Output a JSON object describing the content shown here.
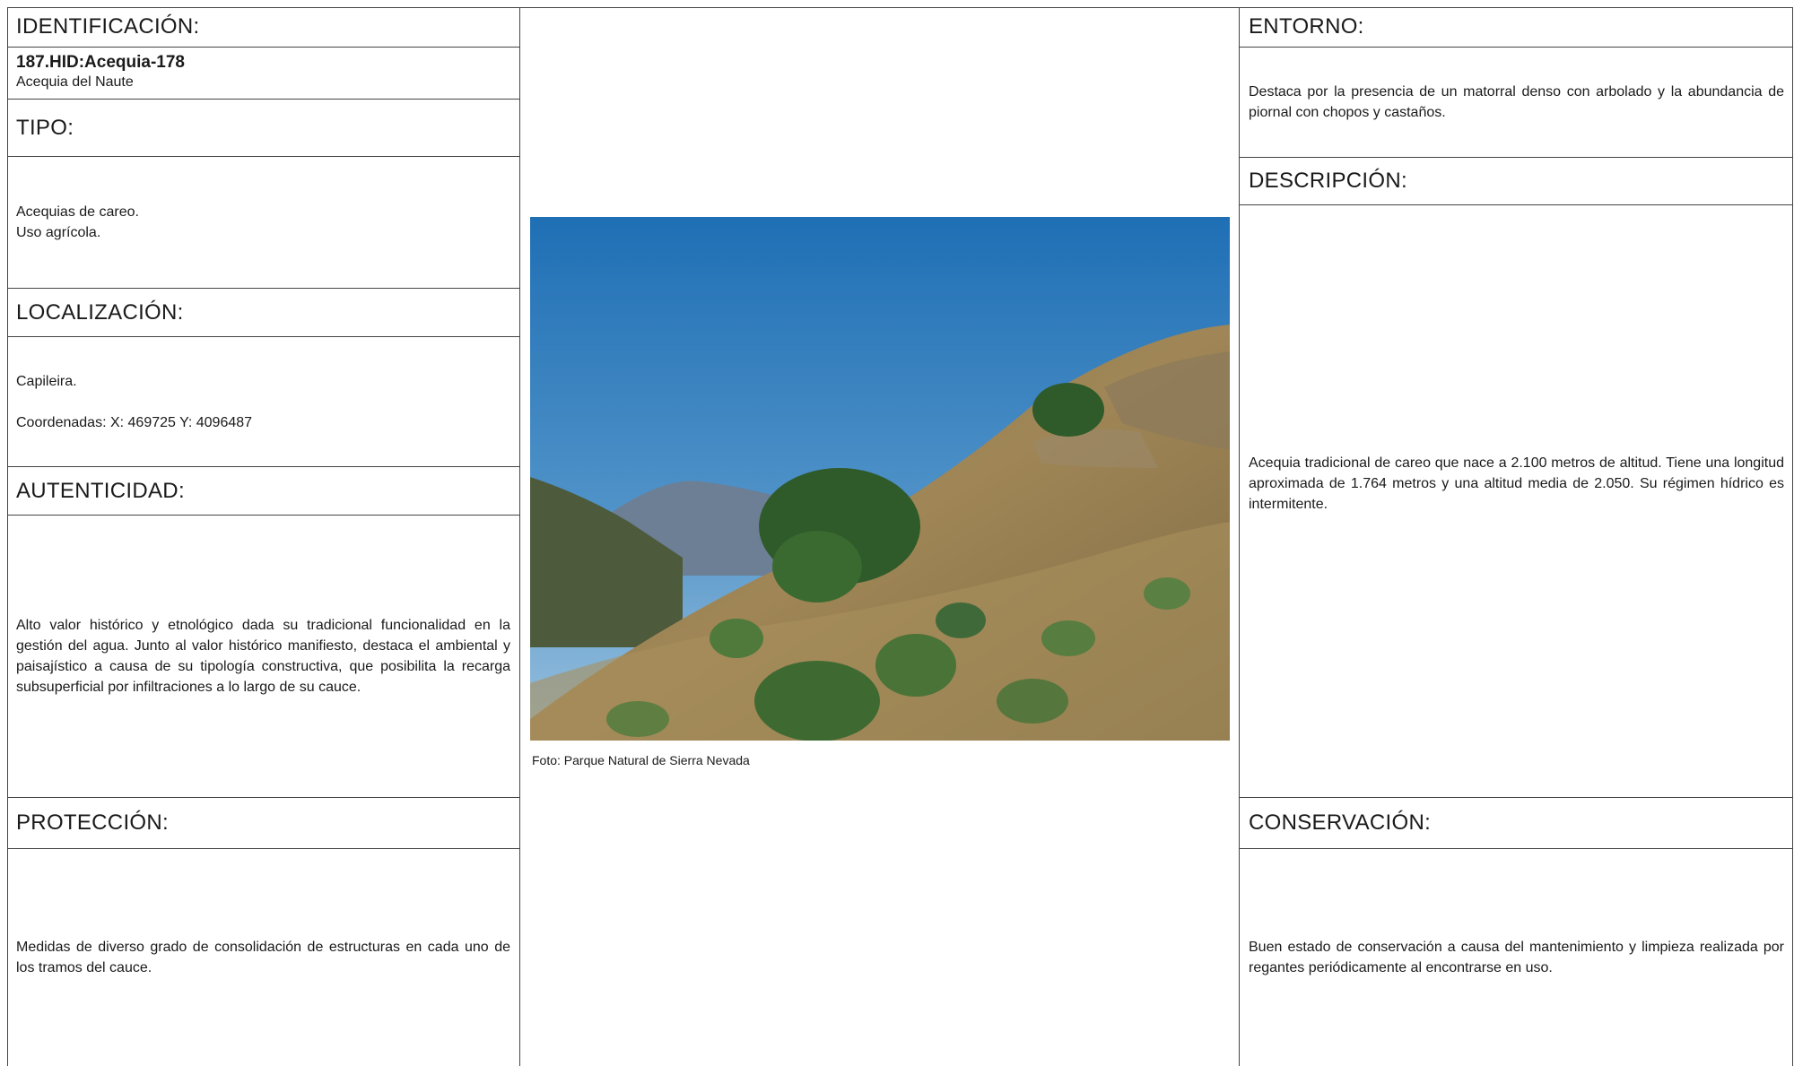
{
  "identificacion": {
    "header": "IDENTIFICACIÓN:",
    "code": "187.HID:Acequia-178",
    "name": "Acequia del Naute"
  },
  "tipo": {
    "header": "TIPO:",
    "line1": "Acequias de careo.",
    "line2": "Uso agrícola."
  },
  "localizacion": {
    "header": "LOCALIZACIÓN:",
    "place": "Capileira.",
    "coords": "Coordenadas: X: 469725 Y: 4096487"
  },
  "autenticidad": {
    "header": "AUTENTICIDAD:",
    "text": "Alto valor histórico y etnológico dada su tradicional funcionalidad en la gestión del agua. Junto al valor histórico manifiesto, destaca el ambiental y paisajístico a causa de su tipología constructiva, que posibilita la recarga subsuperficial por infiltraciones a lo largo de su cauce."
  },
  "proteccion": {
    "header": "PROTECCIÓN:",
    "text": "Medidas de diverso grado de consolidación de estructuras en cada uno de los tramos del cauce."
  },
  "photo": {
    "caption": "Foto: Parque Natural de Sierra Nevada",
    "colors": {
      "sky_top": "#1f6fb5",
      "sky_bottom": "#7fb0d6",
      "hill": "#9c7f4f",
      "shrub": "#2f5a2a"
    }
  },
  "entorno": {
    "header": "ENTORNO:",
    "text": "Destaca por la presencia de un matorral denso con arbolado y la abundancia de piornal con chopos y castaños."
  },
  "descripcion": {
    "header": "DESCRIPCIÓN:",
    "text": "Acequia tradicional de careo que nace a 2.100 metros de altitud. Tiene una longitud aproximada de 1.764 metros y una altitud media de 2.050. Su régimen hídrico es intermitente."
  },
  "conservacion": {
    "header": "CONSERVACIÓN:",
    "text": "Buen estado de conservación a causa del mantenimiento y limpieza realizada por regantes periódicamente al encontrarse en uso."
  }
}
